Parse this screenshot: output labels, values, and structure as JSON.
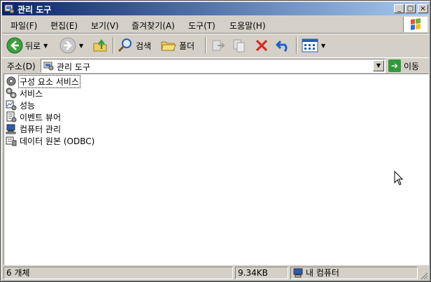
{
  "window": {
    "title": "관리 도구"
  },
  "menu": {
    "items": [
      "파일(F)",
      "편집(E)",
      "보기(V)",
      "즐겨찾기(A)",
      "도구(T)",
      "도움말(H)"
    ]
  },
  "toolbar": {
    "back_label": "뒤로",
    "search_label": "검색",
    "folders_label": "폴더"
  },
  "address": {
    "label": "주소(D)",
    "value": "관리 도구",
    "go_label": "이동"
  },
  "items": [
    {
      "name": "구성 요소 서비스",
      "icon": "component-services-icon",
      "selected": true
    },
    {
      "name": "서비스",
      "icon": "services-gear-icon"
    },
    {
      "name": "성능",
      "icon": "performance-icon"
    },
    {
      "name": "이벤트 뷰어",
      "icon": "event-viewer-icon"
    },
    {
      "name": "컴퓨터 관리",
      "icon": "computer-management-icon"
    },
    {
      "name": "데이터 원본 (ODBC)",
      "icon": "odbc-icon"
    }
  ],
  "status": {
    "objects": "6 개체",
    "size": "9.34KB",
    "zone": "내 컴퓨터"
  }
}
